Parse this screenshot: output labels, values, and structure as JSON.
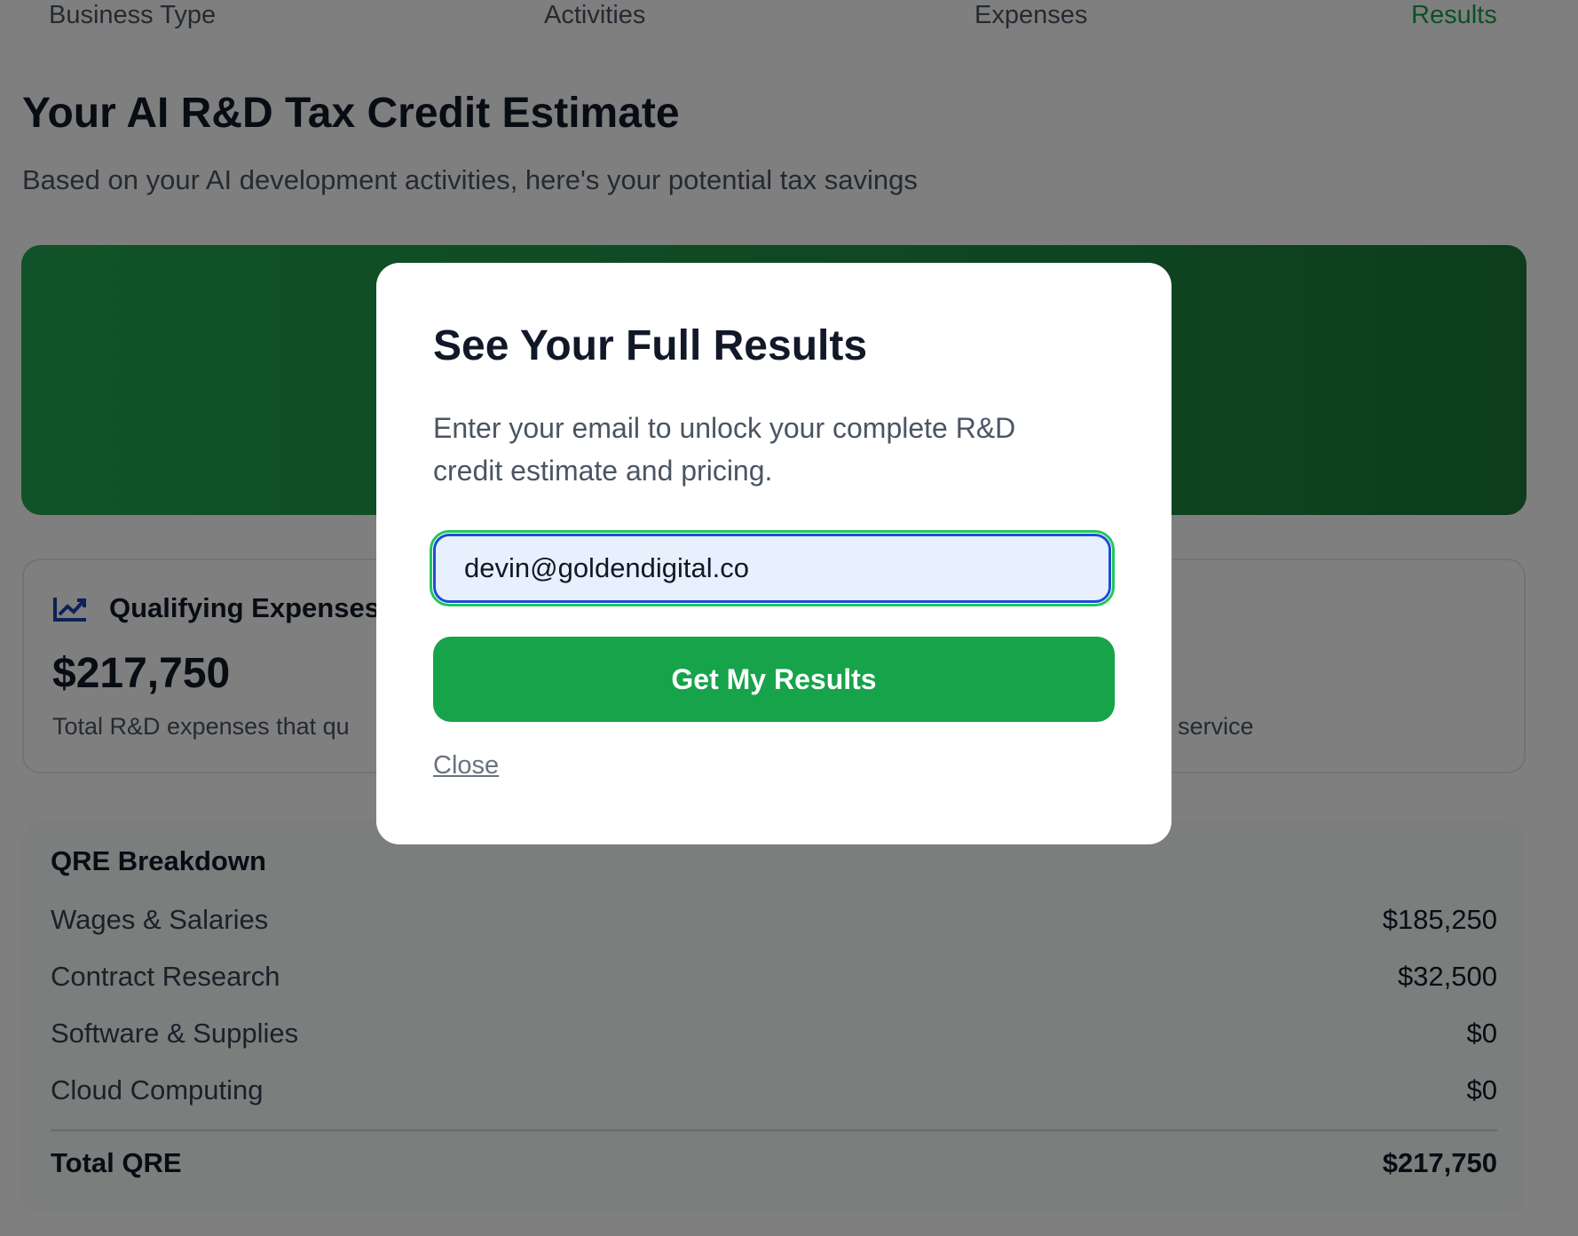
{
  "steps": [
    "Business Type",
    "Activities",
    "Expenses",
    "Results"
  ],
  "header": {
    "title": "Your AI R&D Tax Credit Estimate",
    "subtitle": "Based on your AI development activities, here's your potential tax savings"
  },
  "colors": {
    "accent": "#16a34a",
    "hero": "#1e8f44",
    "input_border": "#1d4ed8"
  },
  "qualifying_card": {
    "icon": "trending-chart-icon",
    "title": "Qualifying Expenses",
    "value": "$217,750",
    "description": "Total R&D expenses that qu",
    "description_right": "service"
  },
  "breakdown": {
    "title": "QRE Breakdown",
    "rows": [
      {
        "label": "Wages & Salaries",
        "value": "$185,250"
      },
      {
        "label": "Contract Research",
        "value": "$32,500"
      },
      {
        "label": "Software & Supplies",
        "value": "$0"
      },
      {
        "label": "Cloud Computing",
        "value": "$0"
      }
    ],
    "total": {
      "label": "Total QRE",
      "value": "$217,750"
    }
  },
  "modal": {
    "title": "See Your Full Results",
    "text": "Enter your email to unlock your complete R&D credit estimate and pricing.",
    "email_value": "devin@goldendigital.co",
    "submit_label": "Get My Results",
    "close_label": "Close"
  }
}
